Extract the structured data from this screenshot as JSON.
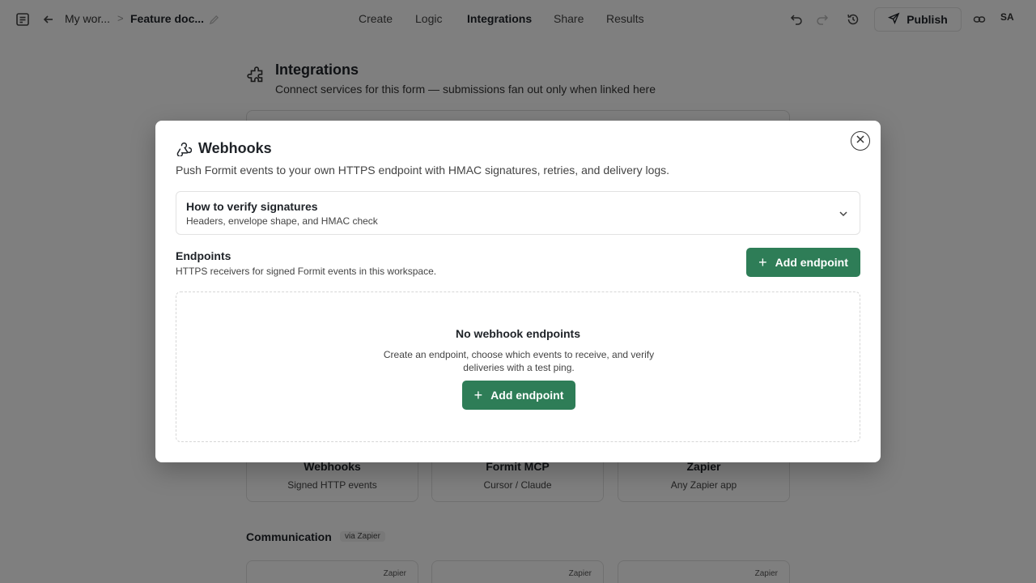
{
  "topbar": {
    "breadcrumb_workspace": "My wor...",
    "breadcrumb_form": "Feature doc...",
    "nav": [
      "Create",
      "Logic",
      "Integrations",
      "Share",
      "Results"
    ],
    "active_nav": "Integrations",
    "publish_label": "Publish",
    "avatar_initials": "SA"
  },
  "page": {
    "title": "Integrations",
    "subtitle": "Connect services for this form — submissions fan out only when linked here",
    "cards": [
      {
        "title": "Webhooks",
        "subtitle": "Signed HTTP events"
      },
      {
        "title": "Formit MCP",
        "subtitle": "Cursor / Claude"
      },
      {
        "title": "Zapier",
        "subtitle": "Any Zapier app"
      }
    ],
    "communication_title": "Communication",
    "communication_badge": "via Zapier",
    "zapier_badge": "Zapier"
  },
  "modal": {
    "title": "Webhooks",
    "description": "Push Formit events to your own HTTPS endpoint with HMAC signatures, retries, and delivery logs.",
    "accordion": {
      "title": "How to verify signatures",
      "subtitle": "Headers, envelope shape, and HMAC check"
    },
    "endpoints": {
      "title": "Endpoints",
      "subtitle": "HTTPS receivers for signed Formit events in this workspace.",
      "add_label": "Add endpoint"
    },
    "empty": {
      "title": "No webhook endpoints",
      "description": "Create an endpoint, choose which events to receive, and verify deliveries with a test ping.",
      "add_label": "Add endpoint"
    }
  },
  "colors": {
    "accent_green": "#2e7d57",
    "overlay": "rgba(0,0,0,0.5)"
  }
}
